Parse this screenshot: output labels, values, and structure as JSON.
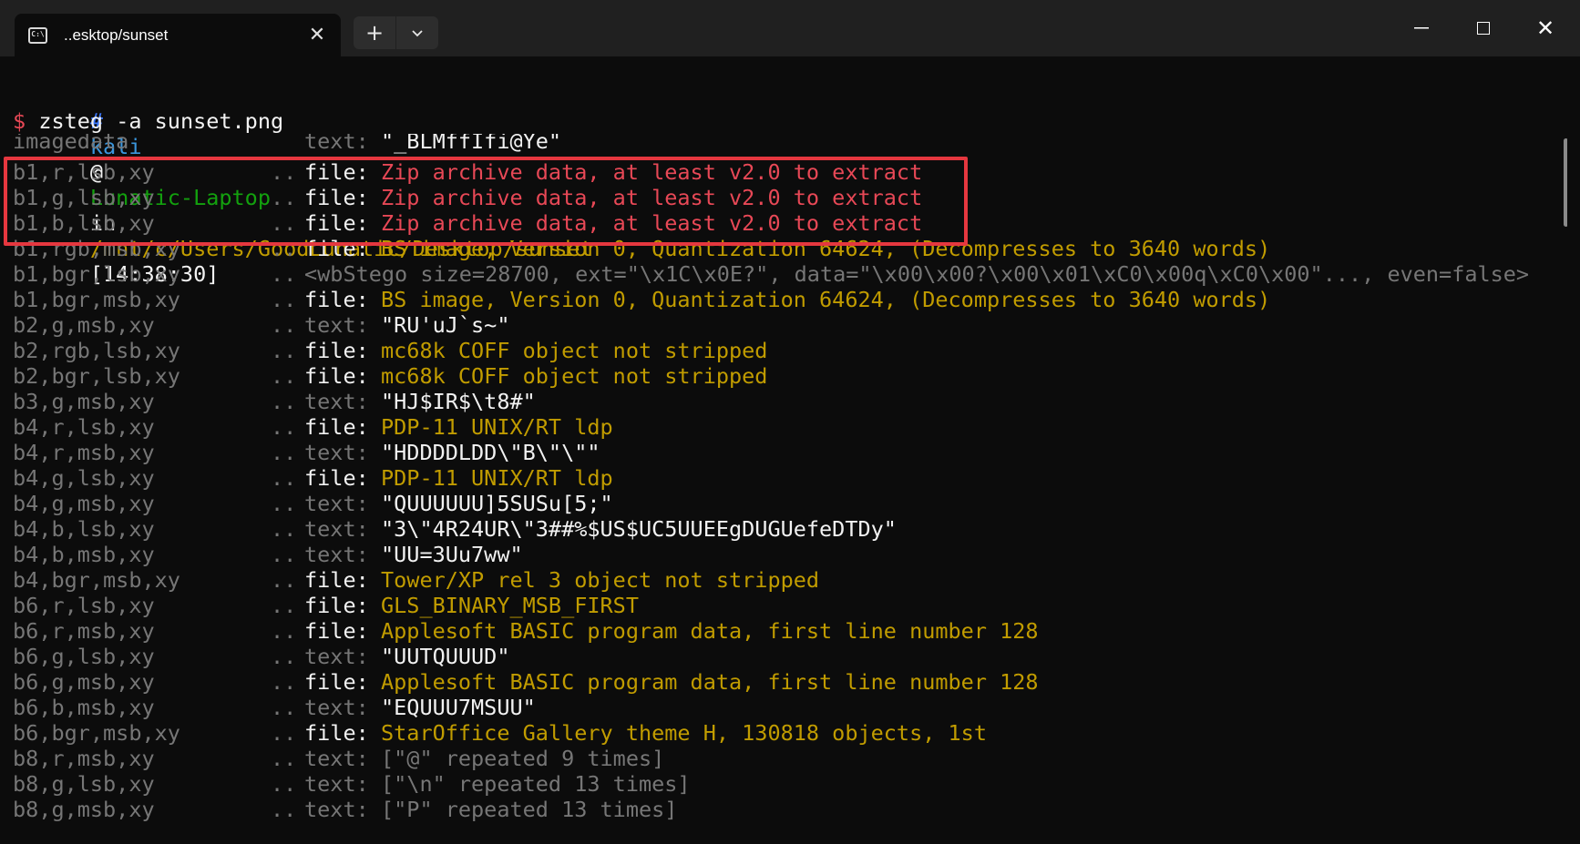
{
  "window": {
    "tab_title": "..esktop/sunset",
    "tab_icon": "terminal-icon",
    "new_tab_label": "+",
    "dropdown_label": "⌄",
    "close_tab": "✕",
    "minimize": "—",
    "close_window": "✕"
  },
  "prompt": {
    "hash": "#",
    "user": "kali",
    "at": "@",
    "host": "Lunatic-Laptop",
    "in": "in",
    "path": "/mnt/c/Users/GoodLunatic/Desktop/sunset",
    "time": "[14:38:30]",
    "dollar": "$",
    "command": "zsteg -a sunset.png"
  },
  "colors": {
    "highlight_border": "#e5373f",
    "file_type": "#c19c00",
    "zip_text": "#e74856",
    "key_gray": "#767676"
  },
  "output": [
    {
      "key": "imagedata",
      "dots": "",
      "kind": "text:",
      "value": "\"_BLMffIfi@Ye\"",
      "style": "partial"
    },
    {
      "key": "b1,r,lsb,xy",
      "dots": "..",
      "kind": "file:",
      "value": "Zip archive data, at least v2.0 to extract",
      "style": "red"
    },
    {
      "key": "b1,g,lsb,xy",
      "dots": "..",
      "kind": "file:",
      "value": "Zip archive data, at least v2.0 to extract",
      "style": "red"
    },
    {
      "key": "b1,b,lsb,xy",
      "dots": "..",
      "kind": "file:",
      "value": "Zip archive data, at least v2.0 to extract",
      "style": "red"
    },
    {
      "key": "b1,rgb,msb,xy",
      "dots": "..",
      "kind": "file:",
      "value": "BS image, Version 0, Quantization 64624, (Decompresses to 3640 words)",
      "style": "yellow"
    },
    {
      "key": "b1,bgr,lsb,xy",
      "dots": "..",
      "kind": "",
      "value": "<wbStego size=28700, ext=\"\\x1C\\x0E?\", data=\"\\x00\\x00?\\x00\\x01\\xC0\\x00q\\xC0\\x00\"..., even=false>",
      "style": "gray"
    },
    {
      "key": "b1,bgr,msb,xy",
      "dots": "..",
      "kind": "file:",
      "value": "BS image, Version 0, Quantization 64624, (Decompresses to 3640 words)",
      "style": "yellow"
    },
    {
      "key": "b2,g,msb,xy",
      "dots": "..",
      "kind": "text:",
      "value": "\"RU'uJ`s~\"",
      "style": "white"
    },
    {
      "key": "b2,rgb,lsb,xy",
      "dots": "..",
      "kind": "file:",
      "value": "mc68k COFF object not stripped",
      "style": "yellow"
    },
    {
      "key": "b2,bgr,lsb,xy",
      "dots": "..",
      "kind": "file:",
      "value": "mc68k COFF object not stripped",
      "style": "yellow"
    },
    {
      "key": "b3,g,msb,xy",
      "dots": "..",
      "kind": "text:",
      "value": "\"HJ$IR$\\t8#\"",
      "style": "white"
    },
    {
      "key": "b4,r,lsb,xy",
      "dots": "..",
      "kind": "file:",
      "value": "PDP-11 UNIX/RT ldp",
      "style": "yellow"
    },
    {
      "key": "b4,r,msb,xy",
      "dots": "..",
      "kind": "text:",
      "value": "\"HDDDDLDD\\\"B\\\"\\\"\"",
      "style": "white"
    },
    {
      "key": "b4,g,lsb,xy",
      "dots": "..",
      "kind": "file:",
      "value": "PDP-11 UNIX/RT ldp",
      "style": "yellow"
    },
    {
      "key": "b4,g,msb,xy",
      "dots": "..",
      "kind": "text:",
      "value": "\"QUUUUUU]5SUSu[5;\"",
      "style": "white"
    },
    {
      "key": "b4,b,lsb,xy",
      "dots": "..",
      "kind": "text:",
      "value": "\"3\\\"4R24UR\\\"3##%$US$UC5UUEEgDUGUefeDTDy\"",
      "style": "white"
    },
    {
      "key": "b4,b,msb,xy",
      "dots": "..",
      "kind": "text:",
      "value": "\"UU=3Uu7ww\"",
      "style": "white"
    },
    {
      "key": "b4,bgr,msb,xy",
      "dots": "..",
      "kind": "file:",
      "value": "Tower/XP rel 3 object not stripped",
      "style": "yellow"
    },
    {
      "key": "b6,r,lsb,xy",
      "dots": "..",
      "kind": "file:",
      "value": "GLS_BINARY_MSB_FIRST",
      "style": "yellow"
    },
    {
      "key": "b6,r,msb,xy",
      "dots": "..",
      "kind": "file:",
      "value": "Applesoft BASIC program data, first line number 128",
      "style": "yellow"
    },
    {
      "key": "b6,g,lsb,xy",
      "dots": "..",
      "kind": "text:",
      "value": "\"UUTQUUUD\"",
      "style": "white"
    },
    {
      "key": "b6,g,msb,xy",
      "dots": "..",
      "kind": "file:",
      "value": "Applesoft BASIC program data, first line number 128",
      "style": "yellow"
    },
    {
      "key": "b6,b,msb,xy",
      "dots": "..",
      "kind": "text:",
      "value": "\"EQUUU7MSUU\"",
      "style": "white"
    },
    {
      "key": "b6,bgr,msb,xy",
      "dots": "..",
      "kind": "file:",
      "value": "StarOffice Gallery theme H, 130818 objects, 1st",
      "style": "yellow"
    },
    {
      "key": "b8,r,msb,xy",
      "dots": "..",
      "kind": "text:",
      "value": "[\"@\" repeated 9 times]",
      "style": "gray"
    },
    {
      "key": "b8,g,lsb,xy",
      "dots": "..",
      "kind": "text:",
      "value": "[\"\\n\" repeated 13 times]",
      "style": "gray"
    },
    {
      "key": "b8,g,msb,xy",
      "dots": "..",
      "kind": "text:",
      "value": "[\"P\" repeated 13 times]",
      "style": "gray"
    }
  ]
}
